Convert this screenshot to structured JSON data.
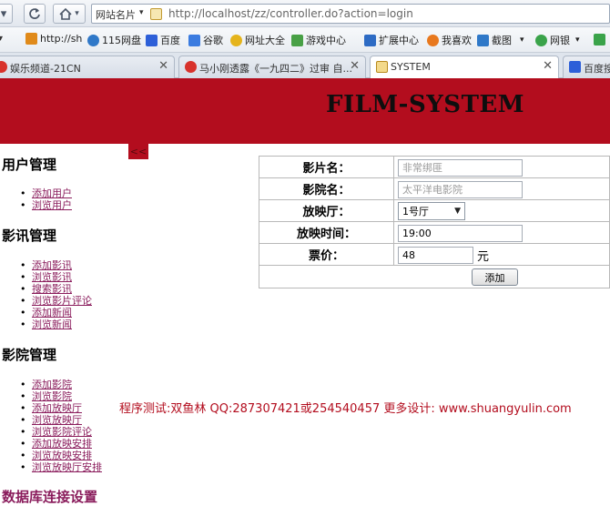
{
  "browser": {
    "site_name": "网站名片",
    "url": "http://localhost/zz/controller.do?action=login",
    "bookmarks": [
      {
        "label": "http://sh",
        "icon": "hao123-icon"
      },
      {
        "label": "115网盘",
        "icon": "cloud-drive-icon"
      },
      {
        "label": "百度",
        "icon": "baidu-paw-icon"
      },
      {
        "label": "谷歌",
        "icon": "google-icon"
      },
      {
        "label": "网址大全",
        "icon": "globe-icon"
      },
      {
        "label": "游戏中心",
        "icon": "gamepad-icon"
      },
      {
        "label": "扩展中心",
        "icon": "puzzle-icon"
      },
      {
        "label": "我喜欢",
        "icon": "heart-icon"
      },
      {
        "label": "截图",
        "icon": "scissors-icon"
      },
      {
        "label": "网银",
        "icon": "bank-icon"
      }
    ],
    "tabs": [
      {
        "label": "娱乐频道-21CN",
        "active": false
      },
      {
        "label": "马小刚透露《一九四二》过审 自...",
        "active": false
      },
      {
        "label": "SYSTEM",
        "active": true
      },
      {
        "label": "百度搜",
        "active": false
      }
    ]
  },
  "page": {
    "banner_title": "FILM-SYSTEM",
    "collapse_label": "<<",
    "sidebar": {
      "user_mgmt": {
        "title": "用户管理",
        "links": [
          "添加用户",
          "浏览用户"
        ]
      },
      "news_mgmt": {
        "title": "影讯管理",
        "links": [
          "添加影讯",
          "浏览影讯",
          "搜索影讯",
          "浏览影片评论",
          "添加新闻",
          "浏览新闻"
        ]
      },
      "cinema_mgmt": {
        "title": "影院管理",
        "links": [
          "添加影院",
          "浏览影院",
          "添加放映厅",
          "浏览放映厅",
          "浏览影院评论",
          "添加放映安排",
          "浏览放映安排",
          "浏览放映厅安排"
        ]
      },
      "db_settings": {
        "title": "数据库连接设置"
      }
    },
    "form": {
      "film_name_label": "影片名：",
      "film_name_value": "非常绑匪",
      "cinema_name_label": "影院名：",
      "cinema_name_value": "太平洋电影院",
      "hall_label": "放映厅：",
      "hall_value": "1号厅",
      "time_label": "放映时间：",
      "time_value": "19:00",
      "price_label": "票价：",
      "price_value": "48",
      "price_unit": "元",
      "submit_label": "添加"
    },
    "credit": "程序测试:双鱼林 QQ:287307421或254540457 更多设计: www.shuangyulin.com"
  },
  "colors": {
    "banner": "#b30d1e",
    "link": "#8a1c5c",
    "credit": "#b30d1e"
  }
}
